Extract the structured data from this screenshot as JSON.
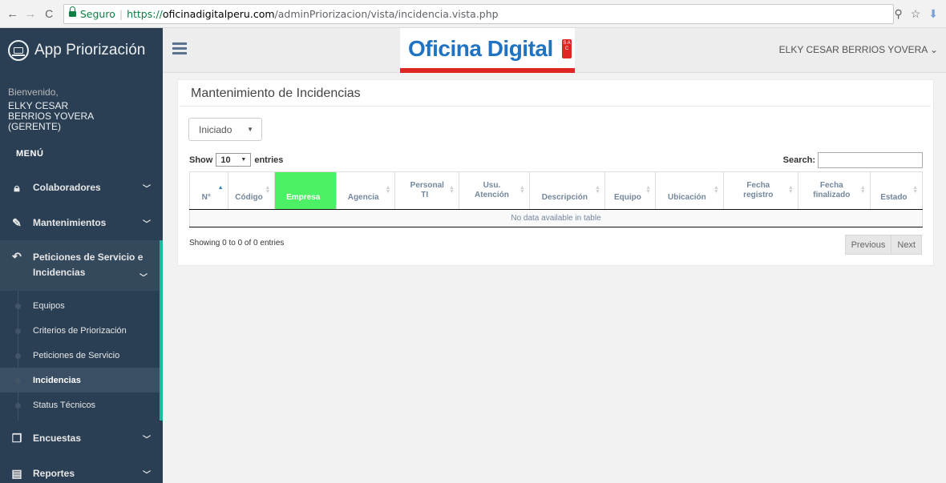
{
  "browser": {
    "secure_label": "Seguro",
    "url_https": "https://",
    "url_host": "oficinadigitalperu.com",
    "url_path": "/adminPriorizacion/vista/incidencia.vista.php"
  },
  "sidebar": {
    "app_title": "App Priorización",
    "welcome": "Bienvenido,",
    "user_name": "ELKY CESAR BERRIOS YOVERA (GERENTE)",
    "menu_title": "MENÚ",
    "items": [
      {
        "label": "Colaboradores",
        "icon": "lock-icon"
      },
      {
        "label": "Mantenimientos",
        "icon": "edit-icon"
      },
      {
        "label": "Peticiones de Servicio e Incidencias",
        "icon": "reply-icon"
      },
      {
        "label": "Encuestas",
        "icon": "copy-icon"
      },
      {
        "label": "Reportes",
        "icon": "file-icon"
      }
    ],
    "submenu": [
      "Equipos",
      "Criterios de Priorización",
      "Peticiones de Servicio",
      "Incidencias",
      "Status Técnicos"
    ]
  },
  "topbar": {
    "brand": "Oficina Digital",
    "brand_sub": "S A C",
    "user_menu": "ELKY CESAR BERRIOS YOVERA ⌄"
  },
  "panel": {
    "title": "Mantenimiento de Incidencias",
    "status_filter": "Iniciado",
    "show": "Show",
    "length": "10",
    "entries": "entries",
    "search_label": "Search:",
    "columns": [
      "N°",
      "Código",
      "Empresa",
      "Agencia",
      "Personal TI",
      "Usu. Atención",
      "Descripción",
      "Equipo",
      "Ubicación",
      "Fecha registro",
      "Fecha finalizado",
      "Estado"
    ],
    "empty_message": "No data available in table",
    "info": "Showing 0 to 0 of 0 entries",
    "previous": "Previous",
    "next": "Next"
  },
  "colors": {
    "sidebar_bg": "#2a3f54",
    "accent": "#1abb9c",
    "highlight_column": "#4cf065",
    "brand_blue": "#1f73c3",
    "brand_red": "#e02525"
  }
}
